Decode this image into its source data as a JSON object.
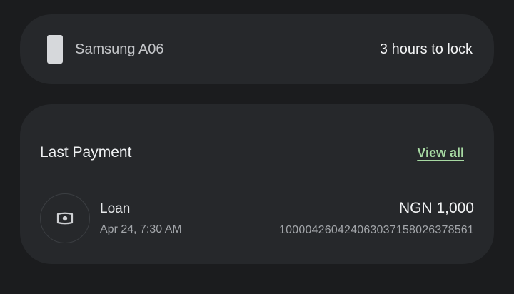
{
  "device": {
    "name": "Samsung A06",
    "lock_status": "3 hours to lock",
    "icon": "phone-icon"
  },
  "payments": {
    "title": "Last Payment",
    "view_all_label": "View all",
    "items": [
      {
        "title": "Loan",
        "datetime": "Apr 24, 7:30 AM",
        "amount": "NGN 1,000",
        "reference": "100004260424063037158026378561",
        "icon": "cash-icon"
      }
    ]
  },
  "colors": {
    "background": "#1b1c1e",
    "card": "#26282b",
    "accent_link": "#a7d9a3"
  }
}
